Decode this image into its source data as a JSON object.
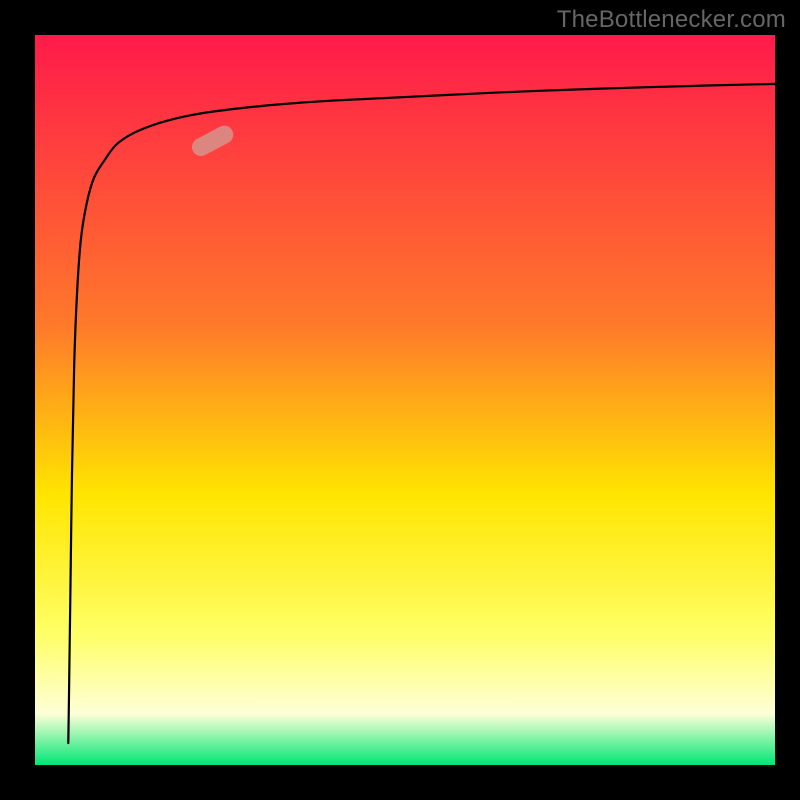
{
  "watermark": "TheBottlenecker.com",
  "chart_data": {
    "type": "line",
    "title": "",
    "xlabel": "",
    "ylabel": "",
    "xlim": [
      0,
      100
    ],
    "ylim": [
      0,
      100
    ],
    "background_gradient": {
      "top": "#ff1a4a",
      "mid_upper": "#ff7a2a",
      "mid": "#ffe500",
      "mid_lower": "#ffff66",
      "lower_band": "#fdffd6",
      "bottom": "#00e676"
    },
    "series": [
      {
        "name": "bottleneck-curve",
        "x": [
          4.5,
          4.6,
          4.8,
          5.0,
          5.3,
          5.7,
          6.2,
          7.0,
          8.0,
          9.5,
          11.0,
          13.0,
          15.5,
          18.0,
          21.0,
          24.0,
          28.0,
          33.0,
          40.0,
          50.0,
          62.0,
          75.0,
          88.0,
          100.0
        ],
        "y": [
          3.0,
          10.0,
          25.0,
          40.0,
          55.0,
          65.0,
          72.0,
          77.0,
          80.5,
          83.0,
          85.0,
          86.4,
          87.5,
          88.3,
          89.0,
          89.5,
          90.0,
          90.5,
          91.0,
          91.5,
          92.1,
          92.6,
          93.0,
          93.3
        ]
      }
    ],
    "marker": {
      "name": "highlight-segment",
      "x_center": 24.0,
      "y_center": 85.5,
      "length_pct": 6.0,
      "angle_deg": -28,
      "color": "#d6938c",
      "opacity": 0.85
    }
  }
}
